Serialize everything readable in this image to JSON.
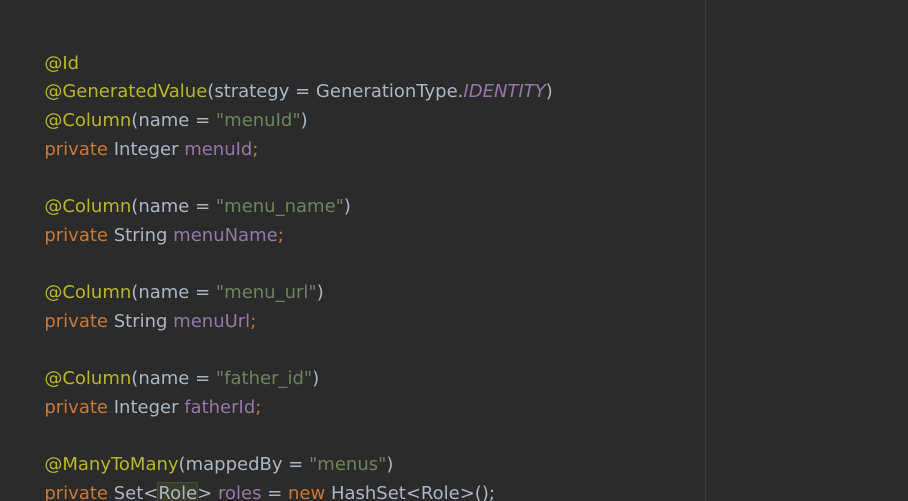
{
  "code": {
    "l1": {
      "ann": "@Id"
    },
    "l2": {
      "ann": "@GeneratedValue",
      "open": "(",
      "param": "strategy",
      "eq": " = ",
      "type": "GenerationType.",
      "const": "IDENTITY",
      "close": ")"
    },
    "l3": {
      "ann": "@Column",
      "open": "(",
      "param": "name",
      "eq": " = ",
      "str": "\"menuId\"",
      "close": ")"
    },
    "l4": {
      "kw": "private",
      "type": " Integer ",
      "field": "menuId",
      "semi": ";"
    },
    "l6": {
      "ann": "@Column",
      "open": "(",
      "param": "name",
      "eq": " = ",
      "str": "\"menu_name\"",
      "close": ")"
    },
    "l7": {
      "kw": "private",
      "type": " String ",
      "field": "menuName",
      "semi": ";"
    },
    "l9": {
      "ann": "@Column",
      "open": "(",
      "param": "name",
      "eq": " = ",
      "str": "\"menu_url\"",
      "close": ")"
    },
    "l10": {
      "kw": "private",
      "type": " String ",
      "field": "menuUrl",
      "semi": ";"
    },
    "l12": {
      "ann": "@Column",
      "open": "(",
      "param": "name",
      "eq": " = ",
      "str": "\"father_id\"",
      "close": ")"
    },
    "l13": {
      "kw": "private",
      "type": " Integer ",
      "field": "fatherId",
      "semi": ";"
    },
    "l15": {
      "ann": "@ManyToMany",
      "open": "(",
      "param": "mappedBy",
      "eq": " = ",
      "str": "\"menus\"",
      "close": ")"
    },
    "l16": {
      "kw": "private",
      "set": " Set<",
      "role": "Role",
      "gt": "> ",
      "field": "roles",
      "eq": " = ",
      "new": "new",
      "rest": " HashSet<Role>();"
    }
  },
  "colors": {
    "background": "#2b2b2b",
    "annotation": "#bbb529",
    "keyword": "#cc7832",
    "string": "#6a8759",
    "field": "#9876aa",
    "text": "#a9b7c6"
  }
}
